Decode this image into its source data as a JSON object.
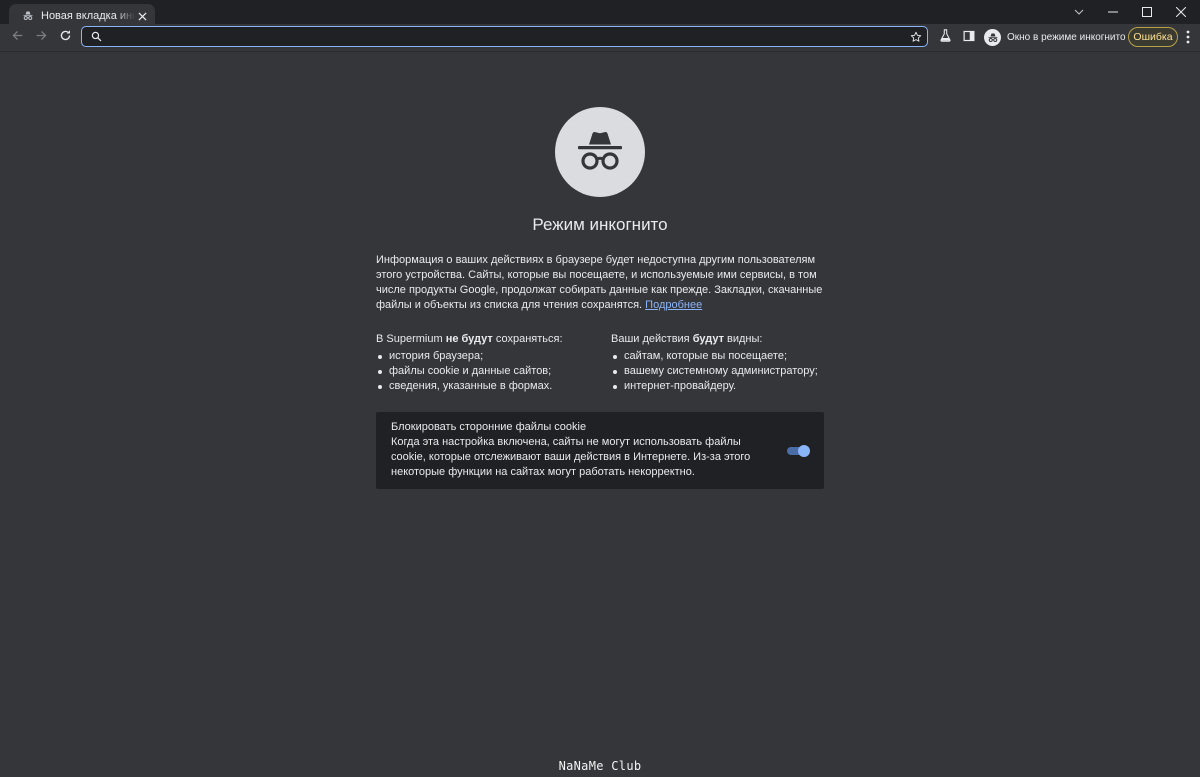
{
  "tab": {
    "title": "Новая вкладка инкогнито",
    "icon": "incognito-icon",
    "close_icon": "close-icon"
  },
  "window_controls": [
    "chevron-down-icon",
    "minimize-icon",
    "maximize-icon",
    "close-icon"
  ],
  "toolbar": {
    "back_icon": "arrow-left-icon",
    "forward_icon": "arrow-right-icon",
    "reload_icon": "reload-icon",
    "omnibox": {
      "value": "",
      "search_icon": "search-icon",
      "bookmark_icon": "star-icon"
    },
    "labs_icon": "flask-icon",
    "side_panel_icon": "side-panel-icon",
    "profile_label": "Окно в режиме инкогнито",
    "error_label": "Ошибка",
    "menu_icon": "more-vert-icon",
    "accent_color": "#8ab4f8"
  },
  "page": {
    "title": "Режим инкогнито",
    "intro": "Информация о ваших действиях в браузере будет недоступна другим пользователям этого устройства. Сайты, которые вы посещаете, и используемые ими сервисы, в том числе продукты Google, продолжат собирать данные как прежде. Закладки, скачанные файлы и объекты из списка для чтения сохранятся.",
    "learn_more": "Подробнее",
    "not_saved": {
      "heading_prefix": "В Supermium ",
      "heading_bold": "не будут",
      "heading_suffix": " сохраняться:",
      "items": [
        "история браузера;",
        "файлы cookie и данные сайтов;",
        "сведения, указанные в формах."
      ]
    },
    "visible_to": {
      "heading_prefix": "Ваши действия ",
      "heading_bold": "будут",
      "heading_suffix": " видны:",
      "items": [
        "сайтам, которые вы посещаете;",
        "вашему системному администратору;",
        "интернет-провайдеру."
      ]
    },
    "cookie_card": {
      "title": "Блокировать сторонние файлы cookie",
      "description": "Когда эта настройка включена, сайты не могут использовать файлы cookie, которые отслеживают ваши действия в Интернете. Из-за этого некоторые функции на сайтах могут работать некорректно.",
      "toggle_on": true
    }
  },
  "watermark": "NaNaMe Club"
}
